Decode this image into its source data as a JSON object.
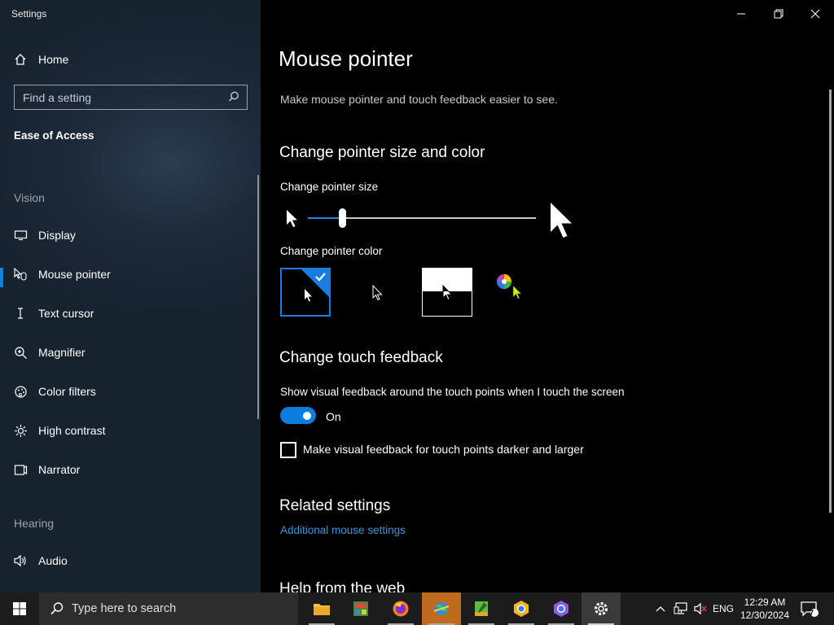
{
  "window": {
    "title": "Settings",
    "controls": [
      "minimize",
      "restore",
      "close"
    ]
  },
  "sidebar": {
    "home_label": "Home",
    "search_placeholder": "Find a setting",
    "section_title": "Ease of Access",
    "groups": [
      {
        "header": "Vision",
        "items": [
          {
            "label": "Display",
            "icon": "monitor-icon"
          },
          {
            "label": "Mouse pointer",
            "icon": "mouse-pointer-icon",
            "active": true
          },
          {
            "label": "Text cursor",
            "icon": "text-cursor-icon"
          },
          {
            "label": "Magnifier",
            "icon": "magnifier-icon"
          },
          {
            "label": "Color filters",
            "icon": "color-filters-icon"
          },
          {
            "label": "High contrast",
            "icon": "high-contrast-icon"
          },
          {
            "label": "Narrator",
            "icon": "narrator-icon"
          }
        ]
      },
      {
        "header": "Hearing",
        "items": [
          {
            "label": "Audio",
            "icon": "audio-icon"
          }
        ]
      }
    ]
  },
  "main": {
    "title": "Mouse pointer",
    "subtitle": "Make mouse pointer and touch feedback easier to see.",
    "pointer_section": {
      "heading": "Change pointer size and color",
      "size_label": "Change pointer size",
      "size_value_fraction": 0.15,
      "color_label": "Change pointer color",
      "color_options": [
        {
          "name": "white",
          "selected": true
        },
        {
          "name": "black",
          "selected": false
        },
        {
          "name": "inverted",
          "selected": false
        },
        {
          "name": "custom",
          "selected": false
        }
      ]
    },
    "touch_section": {
      "heading": "Change touch feedback",
      "show_label": "Show visual feedback around the touch points when I touch the screen",
      "toggle_state": "On",
      "darker_label": "Make visual feedback for touch points darker and larger",
      "darker_checked": false
    },
    "related": {
      "heading": "Related settings",
      "link": "Additional mouse settings"
    },
    "help_heading": "Help from the web"
  },
  "taskbar": {
    "search_placeholder": "Type here to search",
    "apps": [
      "file-explorer",
      "photo-editor",
      "firefox",
      "globe-app",
      "notes-app",
      "chrome-canary",
      "chrome",
      "settings"
    ],
    "tray": {
      "language": "ENG",
      "time": "12:29 AM",
      "date": "12/30/2024",
      "notification_count": "7"
    }
  },
  "colors": {
    "accent": "#0a7ee0",
    "link": "#3c93d9",
    "sidebar_bg": "#1d2a3a"
  }
}
